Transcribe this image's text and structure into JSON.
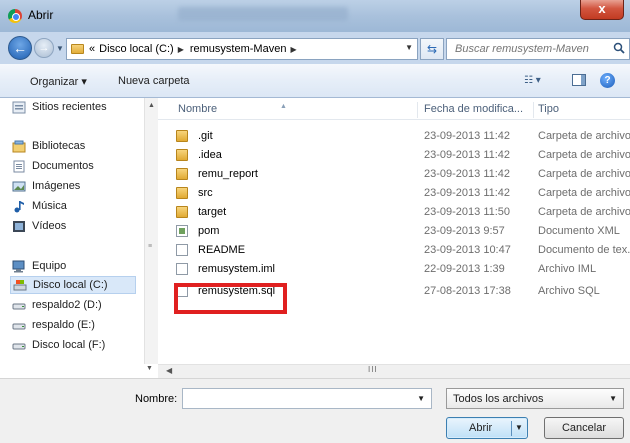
{
  "window": {
    "title": "Abrir",
    "close_symbol": "x"
  },
  "address": {
    "crumbs": [
      "«",
      "Disco local (C:)",
      "remusystem-Maven"
    ],
    "search_placeholder": "Buscar remusystem-Maven"
  },
  "toolbar": {
    "organizar": "Organizar ▾",
    "nueva_carpeta": "Nueva carpeta"
  },
  "sidebar": {
    "items": [
      {
        "label": "Sitios recientes",
        "icon": "recent-places-icon"
      },
      {
        "label": "Bibliotecas",
        "icon": "libraries-icon"
      },
      {
        "label": "Documentos",
        "icon": "documents-icon"
      },
      {
        "label": "Imágenes",
        "icon": "pictures-icon"
      },
      {
        "label": "Música",
        "icon": "music-icon"
      },
      {
        "label": "Vídeos",
        "icon": "videos-icon"
      },
      {
        "label": "Equipo",
        "icon": "computer-icon"
      },
      {
        "label": "Disco local (C:)",
        "icon": "drive-c-icon",
        "selected": true
      },
      {
        "label": "respaldo2 (D:)",
        "icon": "drive-icon"
      },
      {
        "label": "respaldo (E:)",
        "icon": "drive-icon"
      },
      {
        "label": "Disco local (F:)",
        "icon": "drive-icon"
      }
    ]
  },
  "columns": {
    "name": "Nombre",
    "date": "Fecha de modifica...",
    "type": "Tipo"
  },
  "files": [
    {
      "name": ".git",
      "date": "23-09-2013 11:42",
      "type": "Carpeta de archivo",
      "icon": "folder-icon"
    },
    {
      "name": ".idea",
      "date": "23-09-2013 11:42",
      "type": "Carpeta de archivo",
      "icon": "folder-icon"
    },
    {
      "name": "remu_report",
      "date": "23-09-2013 11:42",
      "type": "Carpeta de archivo",
      "icon": "folder-icon"
    },
    {
      "name": "src",
      "date": "23-09-2013 11:42",
      "type": "Carpeta de archivo",
      "icon": "folder-icon"
    },
    {
      "name": "target",
      "date": "23-09-2013 11:50",
      "type": "Carpeta de archivo",
      "icon": "folder-icon"
    },
    {
      "name": "pom",
      "date": "23-09-2013 9:57",
      "type": "Documento XML",
      "icon": "xml-file-icon"
    },
    {
      "name": "README",
      "date": "23-09-2013 10:47",
      "type": "Documento de tex...",
      "icon": "text-file-icon"
    },
    {
      "name": "remusystem.iml",
      "date": "22-09-2013 1:39",
      "type": "Archivo IML",
      "icon": "file-icon"
    },
    {
      "name": "remusystem.sql",
      "date": "27-08-2013 17:38",
      "type": "Archivo SQL",
      "icon": "file-icon",
      "highlighted": true
    }
  ],
  "bottom": {
    "nombre_label": "Nombre:",
    "filename_value": "",
    "filetype": "Todos los archivos",
    "open_label": "Abrir",
    "cancel_label": "Cancelar"
  },
  "colors": {
    "highlight": "#e02020",
    "selection": "#d9e8f9",
    "title_bar": "#a9c1dc",
    "close": "#c23b22"
  }
}
